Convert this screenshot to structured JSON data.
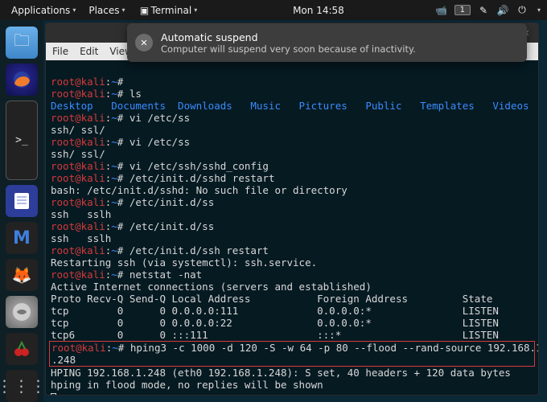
{
  "topbar": {
    "applications": "Applications",
    "places": "Places",
    "terminal": "Terminal",
    "clock": "Mon 14:58",
    "workspace": "1"
  },
  "dock": {
    "items": [
      {
        "name": "files-icon",
        "glyph": "🗀"
      },
      {
        "name": "firefox-icon",
        "glyph": "🦊"
      },
      {
        "name": "terminal-icon",
        "glyph": ">_"
      },
      {
        "name": "notes-icon",
        "glyph": "📄"
      },
      {
        "name": "metasploit-icon",
        "glyph": "M"
      },
      {
        "name": "kali-fox-icon",
        "glyph": "🦊"
      },
      {
        "name": "wireshark-icon",
        "glyph": "◎"
      },
      {
        "name": "cherrytree-icon",
        "glyph": "🍒"
      },
      {
        "name": "show-apps-icon",
        "glyph": "⋮⋮⋮"
      }
    ]
  },
  "notification": {
    "title": "Automatic suspend",
    "body": "Computer will suspend very soon because of inactivity.",
    "icon_glyph": "✕"
  },
  "window": {
    "menubar": [
      "File",
      "Edit",
      "View"
    ],
    "controls": {
      "min": "–",
      "max": "▫",
      "close": "✕"
    }
  },
  "terminal": {
    "prompt_user": "root@kali",
    "prompt_path": "~",
    "ls_output": "Desktop   Documents  Downloads   Music   Pictures   Public   Templates   Videos",
    "lines": {
      "l0": "root@kali:~#",
      "l1_cmd": "ls",
      "l3_cmd": "vi /etc/ss",
      "l4": "ssh/ ssl/",
      "l5_cmd": "vi /etc/ss",
      "l6": "ssh/ ssl/",
      "l7_cmd": "vi /etc/ssh/sshd_config",
      "l8_cmd": "/etc/init.d/sshd restart",
      "l9": "bash: /etc/init.d/sshd: No such file or directory",
      "l10_cmd": "/etc/init.d/ss",
      "l11": "ssh   sslh",
      "l12_cmd": "/etc/init.d/ss",
      "l13": "ssh   sslh",
      "l14_cmd": "/etc/init.d/ssh restart",
      "l15": "Restarting ssh (via systemctl): ssh.service.",
      "l16_cmd": "netstat -nat",
      "l17": "Active Internet connections (servers and established)",
      "l18": "Proto Recv-Q Send-Q Local Address           Foreign Address         State",
      "l19": "tcp        0      0 0.0.0.0:111             0.0.0.0:*               LISTEN",
      "l20": "tcp        0      0 0.0.0.0:22              0.0.0.0:*               LISTEN",
      "l21": "tcp6       0      0 :::111                  :::*                    LISTEN",
      "l22_cmd": "hping3 -c 1000 -d 120 -S -w 64 -p 80 --flood --rand-source 192.168.1",
      "l22b": ".248",
      "l23": "HPING 192.168.1.248 (eth0 192.168.1.248): S set, 40 headers + 120 data bytes",
      "l24": "hping in flood mode, no replies will be shown"
    }
  }
}
